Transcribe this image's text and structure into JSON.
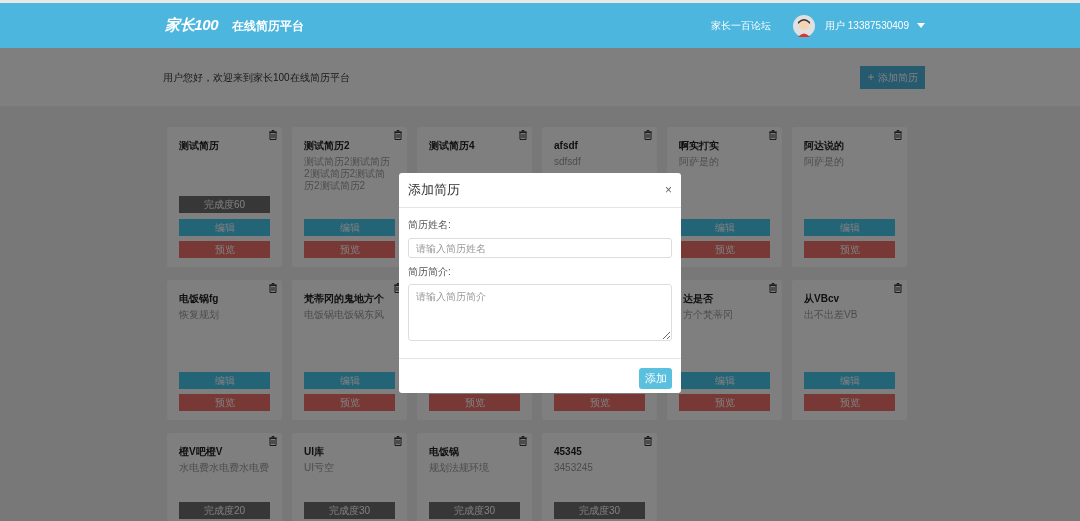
{
  "header": {
    "logo": "家长100",
    "title": "在线简历平台",
    "forum_link": "家长一百论坛",
    "user": "用户 13387530409"
  },
  "welcome": {
    "text": "用户您好，欢迎来到家长100在线简历平台",
    "add_button": "添加简历"
  },
  "cards": [
    {
      "title": "测试简历",
      "buttons": [
        {
          "kind": "progress",
          "label": "完成度60"
        },
        {
          "kind": "edit",
          "label": "编辑"
        },
        {
          "kind": "preview",
          "label": "预览"
        }
      ]
    },
    {
      "title": "测试简历2",
      "description": "测试简历2测试简历2测试简历2测试简历2测试简历2",
      "buttons": [
        {
          "kind": "edit",
          "label": "编辑"
        },
        {
          "kind": "preview",
          "label": "预览"
        }
      ]
    },
    {
      "title": "测试简历4"
    },
    {
      "title": "afsdf",
      "description": "sdfsdf"
    },
    {
      "title": "啊实打实",
      "description": "阿萨是的",
      "buttons": [
        {
          "kind": "edit",
          "label": "编辑"
        },
        {
          "kind": "preview",
          "label": "预览"
        }
      ]
    },
    {
      "title": "阿达说的",
      "description": "阿萨是的",
      "buttons": [
        {
          "kind": "edit",
          "label": "编辑"
        },
        {
          "kind": "preview",
          "label": "预览"
        }
      ]
    },
    {
      "title": "电饭锅fg",
      "description": "恢复规划",
      "buttons": [
        {
          "kind": "edit",
          "label": "编辑"
        },
        {
          "kind": "preview",
          "label": "预览"
        }
      ]
    },
    {
      "title": "梵蒂冈的鬼地方个",
      "description": "电饭锅电饭锅东风",
      "buttons": [
        {
          "kind": "edit",
          "label": "编辑"
        },
        {
          "kind": "preview",
          "label": "预览"
        }
      ]
    },
    {
      "buttons": [
        {
          "kind": "preview",
          "label": "预览"
        }
      ]
    },
    {
      "buttons": [
        {
          "kind": "preview",
          "label": "预览"
        }
      ]
    },
    {
      "title": "达是否",
      "description": "方个梵蒂冈",
      "covered": true,
      "buttons": [
        {
          "kind": "edit",
          "label": "编辑"
        },
        {
          "kind": "preview",
          "label": "预览"
        }
      ]
    },
    {
      "title": "从VBcv",
      "description": "出不出差VB",
      "buttons": [
        {
          "kind": "edit",
          "label": "编辑"
        },
        {
          "kind": "preview",
          "label": "预览"
        }
      ]
    },
    {
      "title": "橙V吧橙V",
      "description": "水电费水电费水电费",
      "buttons": [
        {
          "kind": "progress",
          "label": "完成度20"
        }
      ]
    },
    {
      "title": "UI库",
      "description": "UI亏空",
      "buttons": [
        {
          "kind": "progress",
          "label": "完成度30"
        }
      ]
    },
    {
      "title": "电饭锅",
      "description": "规划法规环境",
      "buttons": [
        {
          "kind": "progress",
          "label": "完成度30"
        }
      ]
    },
    {
      "title": "45345",
      "description": "3453245",
      "buttons": [
        {
          "kind": "progress",
          "label": "完成度30"
        }
      ]
    }
  ],
  "dialog": {
    "title": "添加简历",
    "close": "×",
    "name_label": "简历姓名:",
    "name_placeholder": "请输入简历姓名",
    "intro_label": "简历简介:",
    "intro_placeholder": "请输入简历简介",
    "submit": "添加"
  }
}
